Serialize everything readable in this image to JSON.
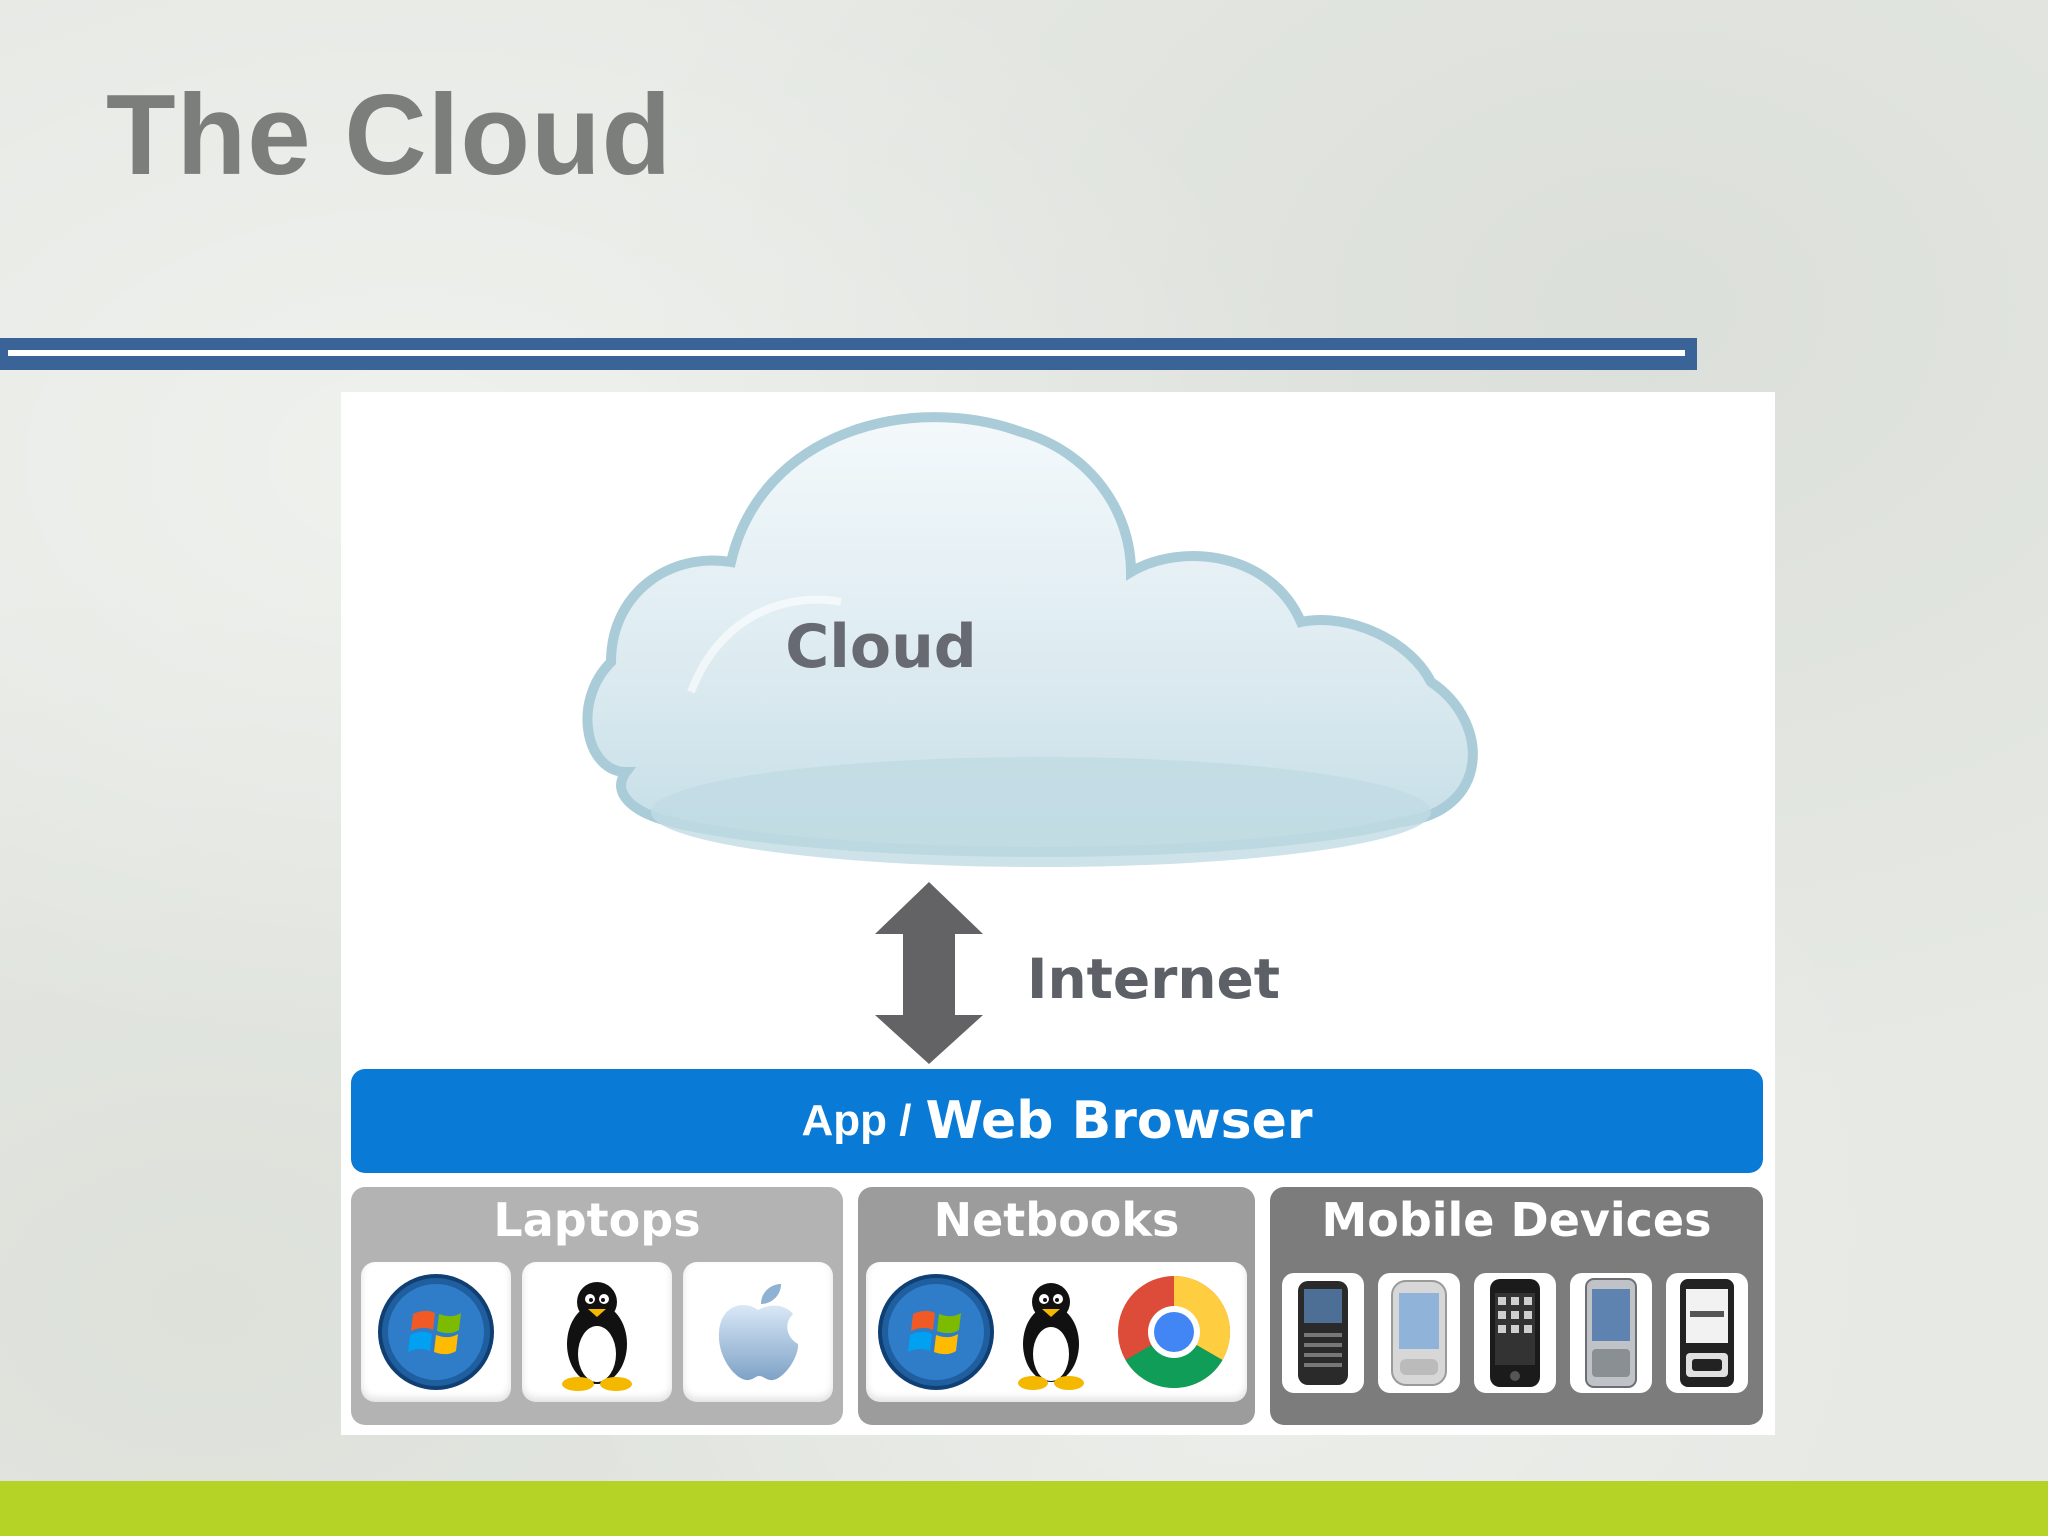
{
  "slide": {
    "title": "The Cloud",
    "accent_colors": {
      "title_rule": "#3a6397",
      "bottom_bar": "#b5d227",
      "browser_bar": "#0a7ad7"
    }
  },
  "diagram": {
    "cloud_label": "Cloud",
    "connector_label": "Internet",
    "browser_prefix": "App /",
    "browser_name": "Web Browser",
    "groups": [
      {
        "label": "Laptops",
        "icons": [
          "windows-icon",
          "linux-tux-icon",
          "apple-icon"
        ]
      },
      {
        "label": "Netbooks",
        "icons": [
          "windows-icon",
          "linux-tux-icon",
          "chrome-icon"
        ]
      },
      {
        "label": "Mobile Devices",
        "icons": [
          "blackberry-phone-icon",
          "android-phone-icon",
          "iphone-icon",
          "windows-mobile-phone-icon",
          "symbian-phone-icon"
        ]
      }
    ]
  }
}
